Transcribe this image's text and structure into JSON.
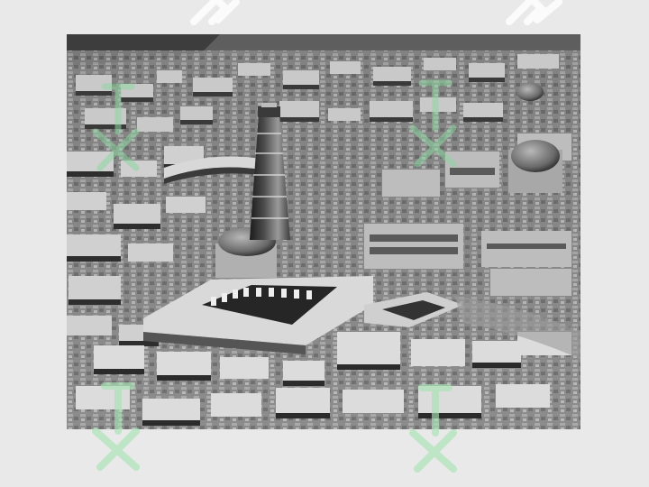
{
  "scene": {
    "subject": "aerial-city-photograph",
    "palette": {
      "background": "#e9e9e9",
      "photo_base": "#7a7a7a",
      "roofs_light": "#d8d8d8",
      "roofs_mid": "#a7a7a7",
      "shadows": "#2f2f2f",
      "watermark_gray": "#ffffff",
      "watermark_green": "#8ed6a1"
    }
  }
}
